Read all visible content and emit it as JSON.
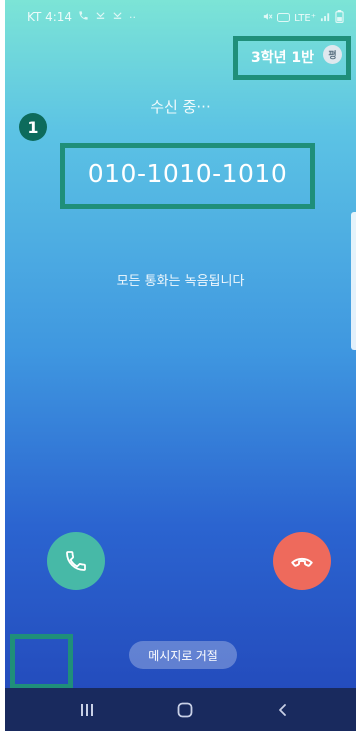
{
  "status_bar": {
    "carrier_time": "KT 4:14",
    "network": "LTE⁺"
  },
  "contact": {
    "group_label": "3학년 1반",
    "group_badge": "평"
  },
  "annotation": {
    "step_number": "1"
  },
  "call": {
    "status_text": "수신 중···",
    "phone_number": "010-1010-1010",
    "record_notice": "모든 통화는 녹음됩니다"
  },
  "actions": {
    "answer_icon": "phone-icon",
    "decline_icon": "phone-hangup-icon",
    "message_reject_label": "메시지로 거절"
  },
  "colors": {
    "annotation_teal": "#1f8f7a",
    "answer": "#47b9a7",
    "decline": "#ee6a5c",
    "nav_bar": "#192a5e"
  },
  "nav": {
    "recent_icon": "recent-apps-icon",
    "home_icon": "home-icon",
    "back_icon": "back-icon"
  }
}
